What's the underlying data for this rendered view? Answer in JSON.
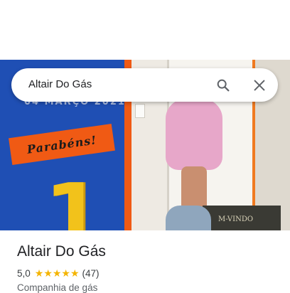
{
  "search": {
    "query": "Altair Do Gás"
  },
  "hero": {
    "banner_date": "04 MARÇO 2021",
    "banner_text": "Parabéns!",
    "banner_number": "1",
    "mat_text": "M-VINDO"
  },
  "place": {
    "name": "Altair Do Gás",
    "rating": "5,0",
    "stars": "★★★★★",
    "review_count": "(47)",
    "category": "Companhia de gás"
  },
  "colors": {
    "accent_star": "#f4b400",
    "banner_blue": "#1f4fb4",
    "banner_orange": "#f05a14"
  }
}
